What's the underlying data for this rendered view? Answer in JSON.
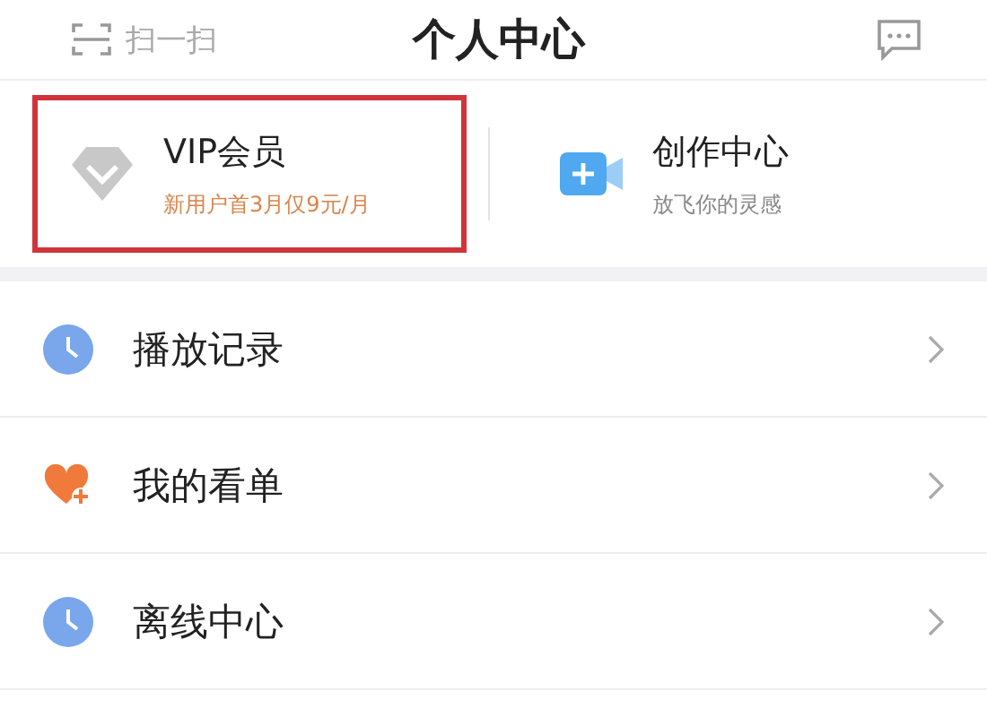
{
  "header": {
    "scan_label": "扫一扫",
    "title": "个人中心"
  },
  "cards": [
    {
      "kind": "vip",
      "title": "VIP会员",
      "subtitle": "新用户首3月仅9元/月",
      "highlighted": true
    },
    {
      "kind": "create",
      "title": "创作中心",
      "subtitle": "放飞你的灵感",
      "highlighted": false
    }
  ],
  "menu": [
    {
      "kind": "history",
      "label": "播放记录"
    },
    {
      "kind": "watchlist",
      "label": "我的看单"
    },
    {
      "kind": "offline",
      "label": "离线中心"
    }
  ]
}
